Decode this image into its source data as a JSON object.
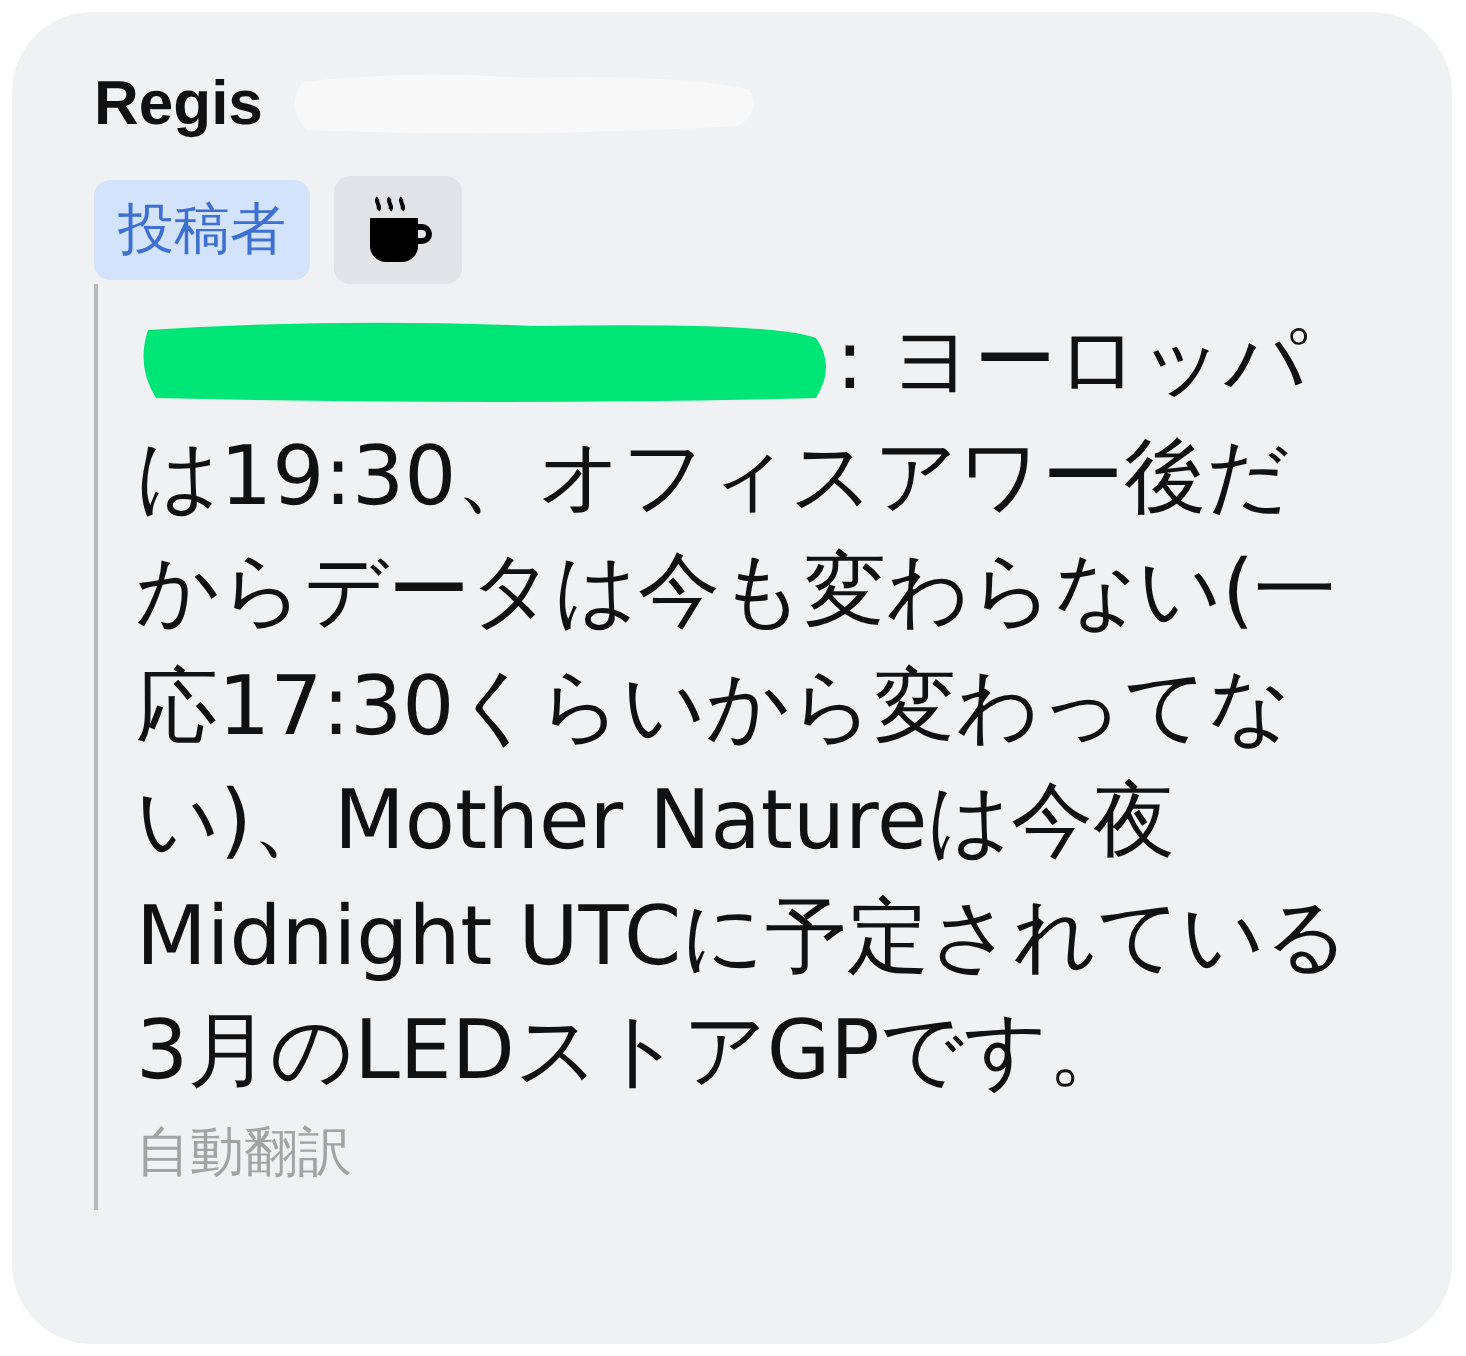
{
  "author": {
    "name": "Regis"
  },
  "badges": [
    {
      "kind": "label",
      "text": "投稿者"
    },
    {
      "kind": "cup"
    }
  ],
  "message_lines": [
    ": ヨーロッパ",
    "は19:30、オフィスアワー後だ",
    "からデータは今も変わらない(一",
    "応17:30くらいから変わってな",
    "い)、Mother Natureは今夜",
    "Midnight UTCに予定されている",
    "3月のLEDストアGPです。"
  ],
  "footer": "自動翻訳"
}
